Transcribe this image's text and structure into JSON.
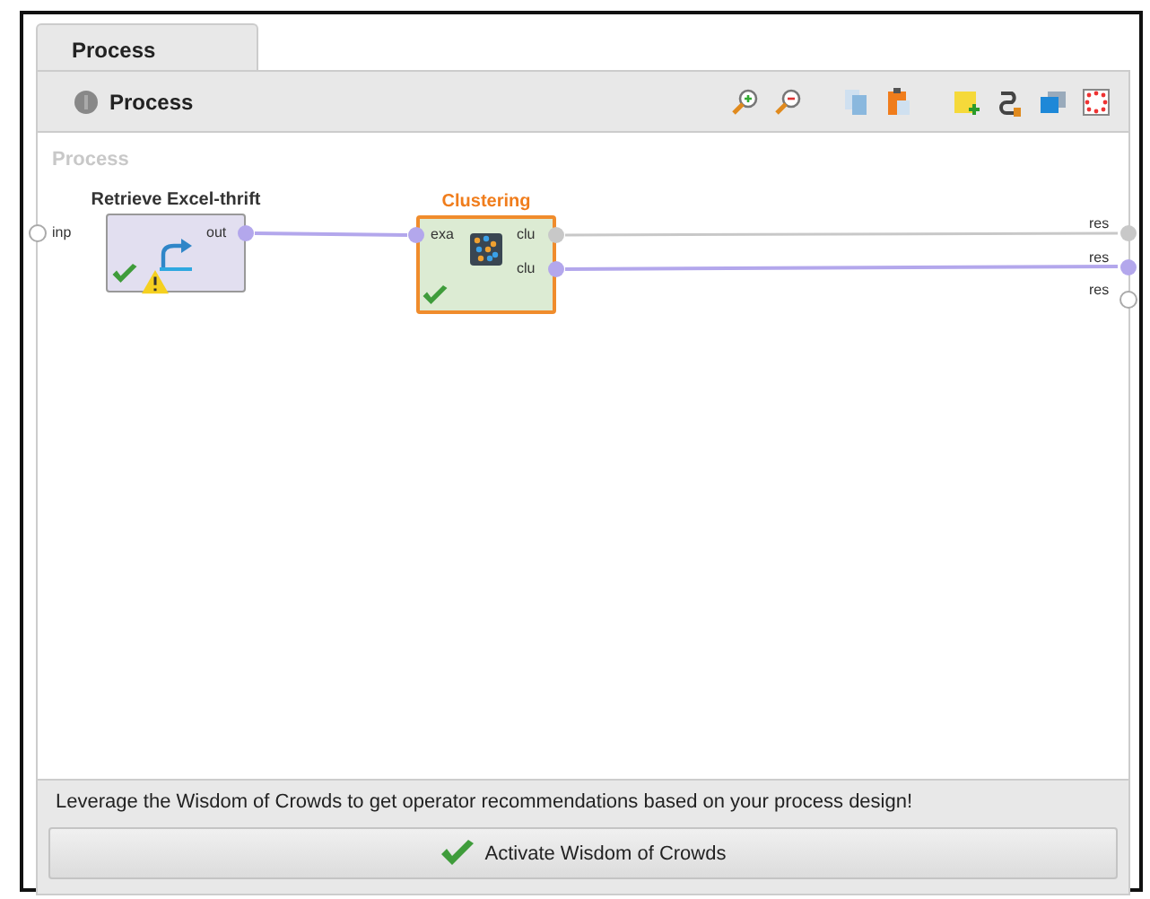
{
  "tab": {
    "label": "Process",
    "selected": true
  },
  "toolbar": {
    "title": "Process"
  },
  "canvas": {
    "label": "Process",
    "input_ports": [
      {
        "label": "inp",
        "connected": false
      }
    ],
    "operators": [
      {
        "name": "Retrieve Excel-thrift",
        "kind": "retrieve",
        "selected": false,
        "ok": true,
        "warning": true,
        "outputs": [
          {
            "label": "out",
            "kind": "data",
            "connected": true
          }
        ]
      },
      {
        "name": "Clustering",
        "kind": "clustering",
        "selected": true,
        "ok": true,
        "warning": false,
        "inputs": [
          {
            "label": "exa",
            "kind": "data",
            "connected": true
          }
        ],
        "outputs": [
          {
            "label": "clu",
            "kind": "model",
            "connected": true
          },
          {
            "label": "clu",
            "kind": "data",
            "connected": true
          }
        ]
      }
    ],
    "result_ports": [
      {
        "label": "res",
        "kind": "model",
        "connected": true
      },
      {
        "label": "res",
        "kind": "data",
        "connected": true
      },
      {
        "label": "res",
        "connected": false
      }
    ]
  },
  "footer": {
    "hint": "Leverage the Wisdom of Crowds to get operator recommendations based on your process design!",
    "button": "Activate Wisdom of Crowds"
  }
}
